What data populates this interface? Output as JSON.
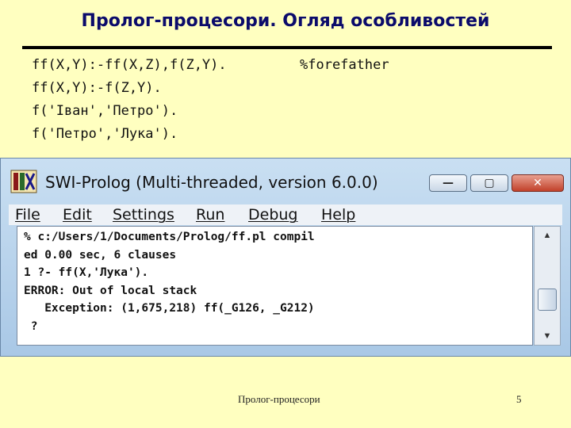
{
  "slide": {
    "title": "Пролог-процесори. Огляд особливостей",
    "code_lines": [
      "ff(X,Y):-ff(X,Z),f(Z,Y).",
      "ff(X,Y):-f(Z,Y).",
      "f('Іван','Петро').",
      "f('Петро','Лука')."
    ],
    "comment": "%forefather"
  },
  "window": {
    "title": "SWI-Prolog (Multi-threaded, version 6.0.0)",
    "controls": {
      "minimize": "—",
      "maximize": "▢",
      "close": "✕"
    },
    "menu": [
      "File",
      "Edit",
      "Settings",
      "Run",
      "Debug",
      "Help"
    ],
    "console_lines": [
      "% c:/Users/1/Documents/Prolog/ff.pl compil",
      "ed 0.00 sec, 6 clauses",
      "1 ?- ff(X,'Лука').",
      "ERROR: Out of local stack",
      "   Exception: (1,675,218) ff(_G126, _G212)",
      " ?"
    ],
    "scrollbar": {
      "up": "▲",
      "down": "▼",
      "position": 0.5
    }
  },
  "footer": {
    "title": "Пролог-процесори",
    "page": "5"
  },
  "colors": {
    "background": "#ffffc0",
    "title": "#0b0b6b",
    "close_button": "#c2412a"
  },
  "icons": {
    "app": "swi-prolog-app-icon"
  }
}
